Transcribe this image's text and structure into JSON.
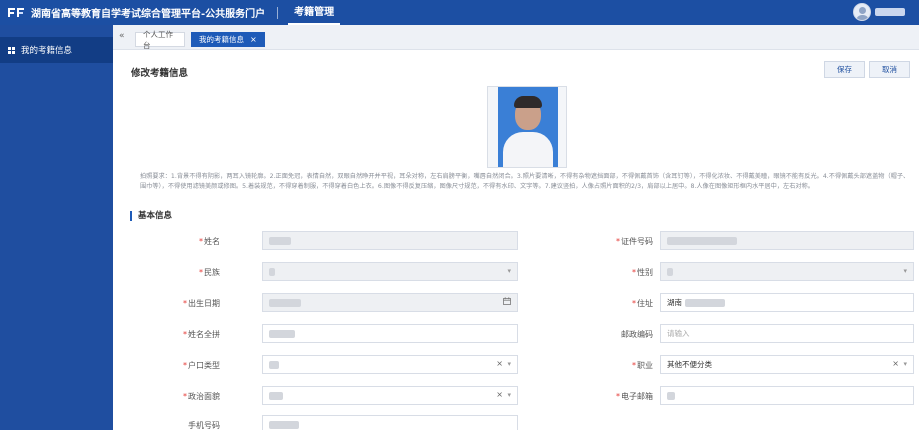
{
  "app": {
    "title": "湖南省高等教育自学考试综合管理平台-公共服务门户",
    "top_menu": "考籍管理"
  },
  "sidebar": {
    "items": [
      {
        "label": "我的考籍信息"
      }
    ]
  },
  "tabs": {
    "collapse": "«",
    "items": [
      {
        "label": "个人工作台"
      },
      {
        "label": "我的考籍信息",
        "close": "×"
      }
    ]
  },
  "page": {
    "title": "修改考籍信息",
    "buttons": {
      "save": "保存",
      "cancel": "取消"
    },
    "notice": "拍照要求：1.背景不得有阴影，两耳入镜轮廓。2.正面免冠，表情自然，双眼自然睁开并平视，耳朵对称，左右肩膀平衡，嘴唇自然闭合。3.照片要清晰，不得有杂物遮挡面部，不得佩戴首饰（含耳钉等），不得化浓妆、不得戴美瞳，眼镜不能有反光。4.不得佩戴头部遮盖物（帽子、围巾等），不得使用滤镜美颜或修图。5.着装规范，不得穿着制服，不得穿着白色上衣。6.图像不得反复压缩，图像尺寸规范，不得有水印、文字等。7.建议竖拍，人像占照片面积的2/3，肩部以上居中。8.人像在图像矩形框内水平居中，左右对称。",
    "section": "基本信息"
  },
  "form": {
    "name": {
      "label": "姓名",
      "required": true
    },
    "id_number": {
      "label": "证件号码",
      "required": true
    },
    "ethnicity": {
      "label": "民族",
      "required": true
    },
    "gender": {
      "label": "性别",
      "required": true
    },
    "birth_date": {
      "label": "出生日期",
      "required": true
    },
    "address": {
      "label": "住址",
      "required": true,
      "value": "湖南"
    },
    "name_pinyin": {
      "label": "姓名全拼",
      "required": true
    },
    "postal_code": {
      "label": "邮政编码",
      "required": false,
      "placeholder": "请输入"
    },
    "household_type": {
      "label": "户口类型",
      "required": true
    },
    "occupation": {
      "label": "职业",
      "required": true,
      "value": "其他不便分类"
    },
    "political_status": {
      "label": "政治面貌",
      "required": true
    },
    "email": {
      "label": "电子邮箱",
      "required": true
    },
    "phone": {
      "label": "手机号码",
      "required": false
    }
  },
  "colors": {
    "header": "#1c4fa3",
    "sidebar": "#1f4ea0",
    "sidebar_active": "#123d85",
    "accent": "#1e5bb8",
    "required": "#e53935"
  },
  "icons": {
    "logo": "logo-icon",
    "menu": "grid-icon",
    "calendar": "calendar-icon",
    "clear": "close-icon",
    "dropdown": "chevron-down-icon"
  }
}
